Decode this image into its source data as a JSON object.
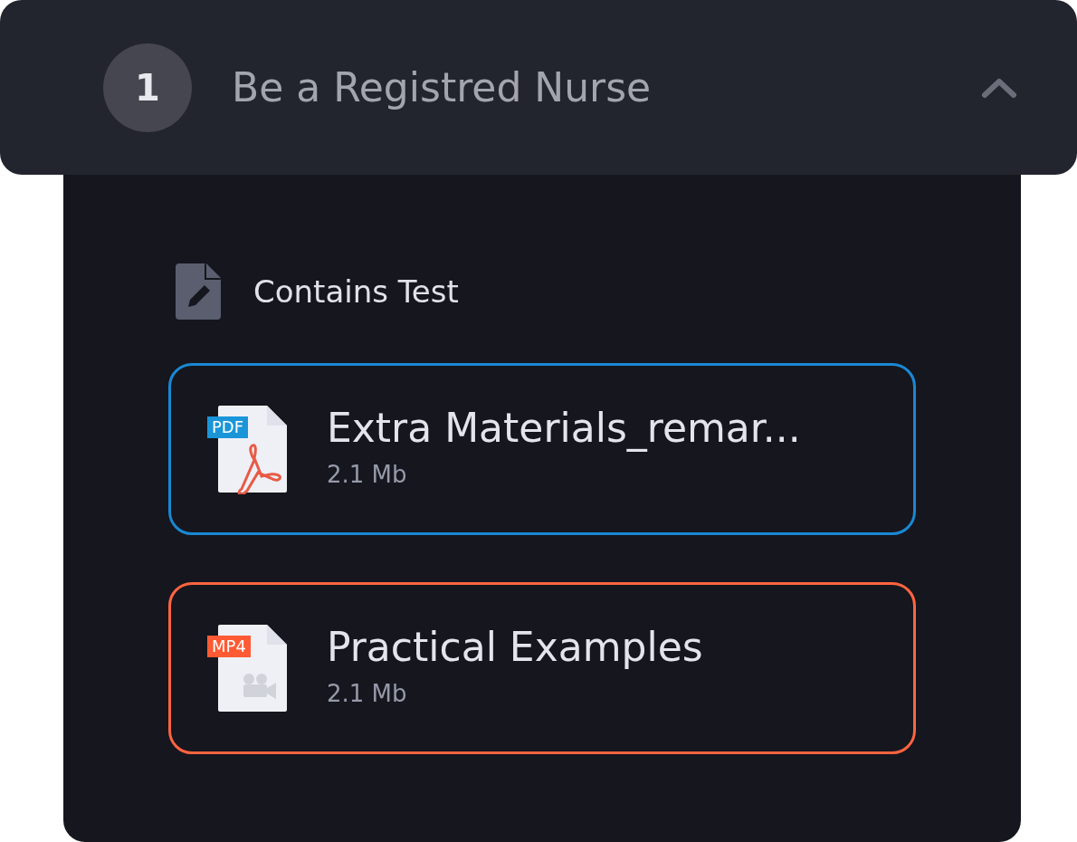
{
  "section": {
    "number": "1",
    "title": "Be a Registred Nurse",
    "expanded": true
  },
  "test_note": "Contains Test",
  "files": [
    {
      "kind": "pdf",
      "badge": "PDF",
      "name": "Extra Materials_remar...",
      "size": "2.1 Mb",
      "color": "#1a88d2"
    },
    {
      "kind": "mp4",
      "badge": "MP4",
      "name": "Practical Examples",
      "size": "2.1 Mb",
      "color": "#ff6440"
    }
  ]
}
